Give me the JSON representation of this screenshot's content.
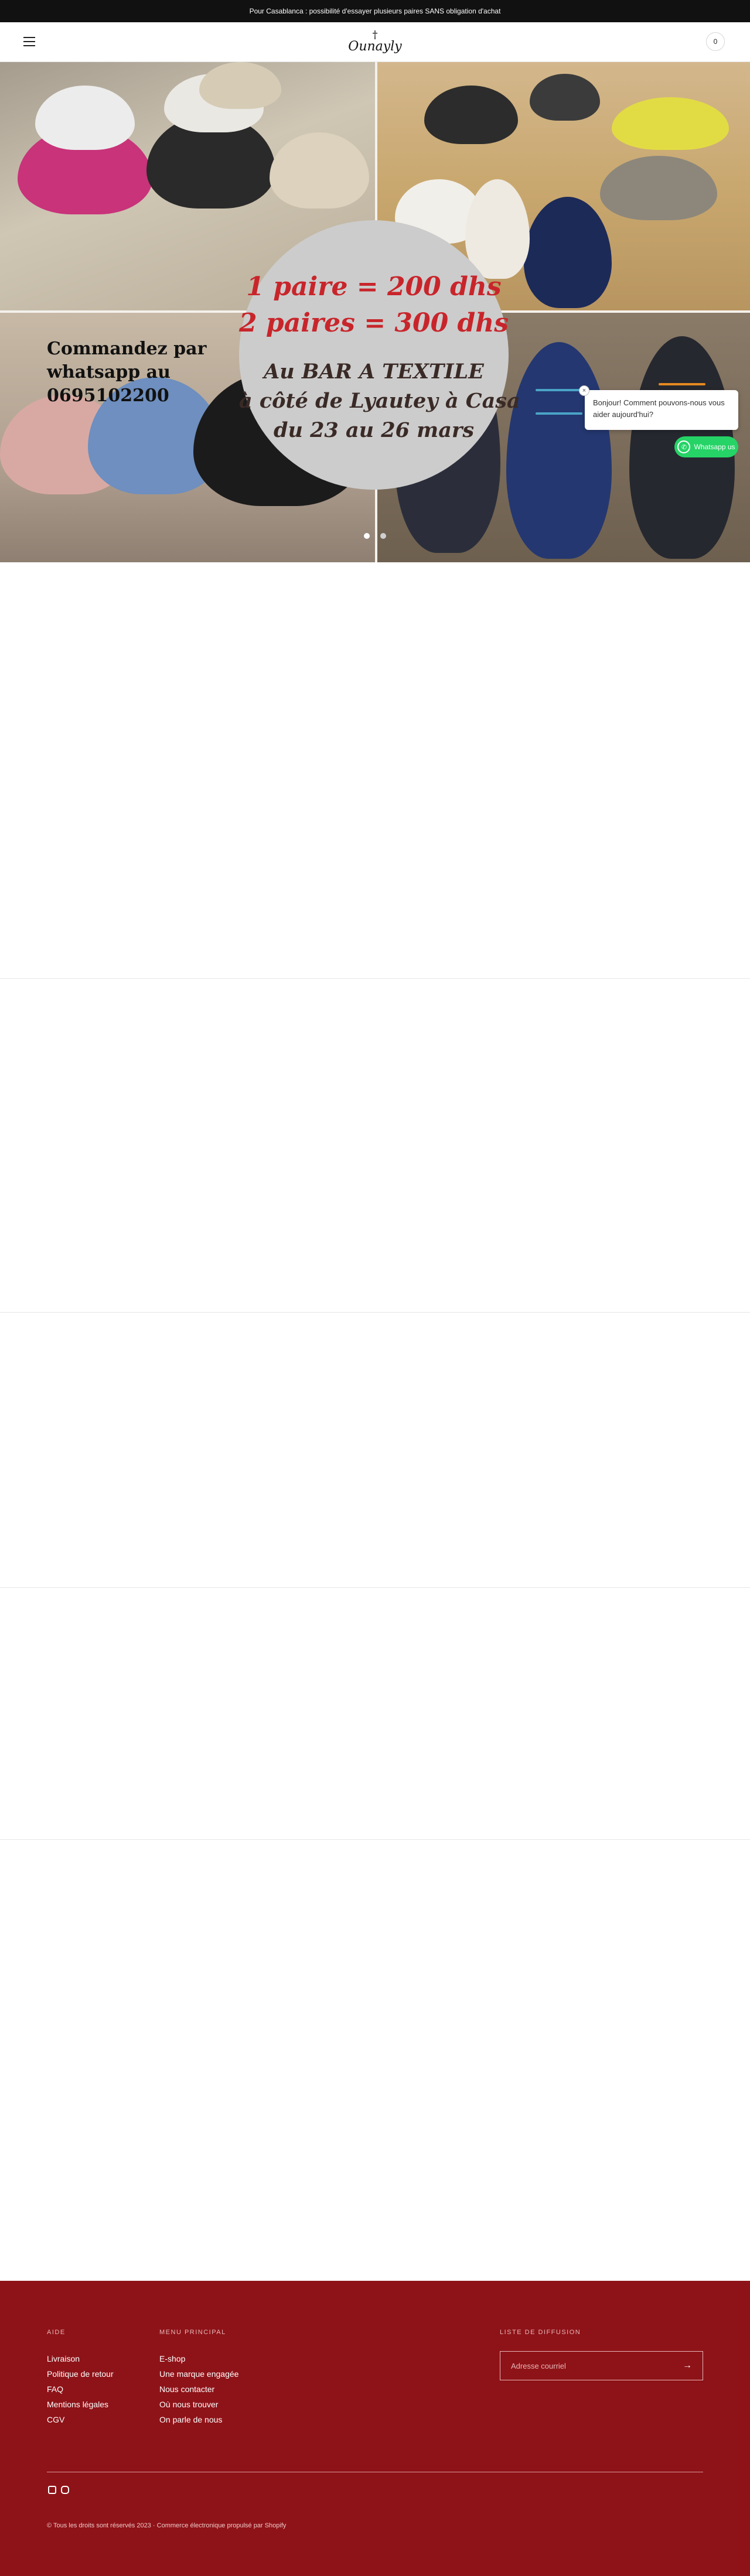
{
  "announcement": {
    "text": "Pour Casablanca : possibilité d'essayer plusieurs paires SANS obligation d'achat"
  },
  "header": {
    "logo_text": "Ounayly",
    "logo_mark": "†",
    "cart_count": "0"
  },
  "hero": {
    "order_lines": [
      "Commandez par",
      "whatsapp au",
      "0695102200"
    ],
    "promo": {
      "line1": "1 paire = 200 dhs",
      "line2": "2 paires = 300 dhs",
      "line3": "Au BAR A TEXTILE",
      "line4": "à côté de Lyautey à Casa",
      "line5": "du 23 au 26 mars"
    },
    "slides_total": 2,
    "slides_active": 1
  },
  "chat": {
    "close_glyph": "×",
    "message": "Bonjour! Comment pouvons-nous vous aider aujourd'hui?",
    "button_label": "Whatsapp us",
    "accent": "#25d366"
  },
  "footer": {
    "background": "#8e1318",
    "aide_title": "AIDE",
    "aide_links": [
      "Livraison",
      "Politique de retour",
      "FAQ",
      "Mentions légales",
      "CGV"
    ],
    "menu_title": "MENU PRINCIPAL",
    "menu_links": [
      "E-shop",
      "Une marque engagée",
      "Nous contacter",
      "Où nous trouver",
      "On parle de nous"
    ],
    "newsletter_title": "LISTE DE DIFFUSION",
    "newsletter_placeholder": "Adresse courriel",
    "newsletter_arrow": "→",
    "social_icons": [
      "facebook-icon",
      "instagram-icon"
    ],
    "copyright": "© Tous les droits sont réservés 2023 · Commerce électronique propulsé par Shopify"
  }
}
